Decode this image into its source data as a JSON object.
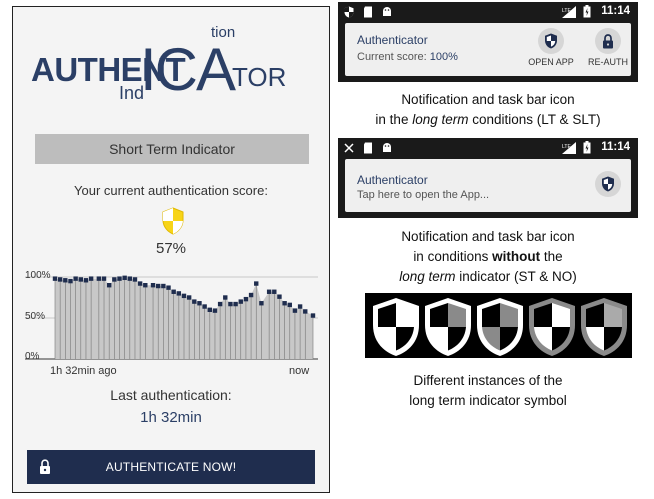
{
  "app": {
    "logo": {
      "part1": "AUTHENT",
      "part2": "ICA",
      "part3": "TOR",
      "superscript": "tion",
      "subscript": "Ind"
    },
    "short_term_indicator_label": "Short Term Indicator",
    "score_label": "Your current authentication score:",
    "score_value": "57%",
    "chart": {
      "y_labels": [
        "100%",
        "50%",
        "0%"
      ],
      "x_start_label": "1h 32min ago",
      "x_end_label": "now",
      "fill_color": "#c8c8c8",
      "point_color": "#1f2d4e"
    },
    "last_auth_label": "Last authentication:",
    "last_auth_value": "1h 32min",
    "authenticate_button": "AUTHENTICATE NOW!"
  },
  "chart_data": {
    "type": "area",
    "x": [
      0,
      2,
      4,
      6,
      8,
      10,
      12,
      14,
      17,
      19,
      21,
      23,
      25,
      27,
      29,
      31,
      33,
      35,
      38,
      40,
      42,
      44,
      46,
      48,
      50,
      52,
      54,
      56,
      58,
      60,
      62,
      64,
      66,
      68,
      70,
      72,
      74,
      76,
      78,
      80,
      83,
      85,
      87,
      89,
      91,
      93,
      95,
      97,
      100
    ],
    "values": [
      98,
      97,
      96,
      95,
      98,
      97,
      96,
      98,
      98,
      98,
      90,
      97,
      98,
      99,
      98,
      97,
      92,
      90,
      90,
      89,
      89,
      87,
      82,
      80,
      77,
      75,
      70,
      68,
      64,
      60,
      59,
      67,
      75,
      67,
      67,
      70,
      73,
      78,
      92,
      68,
      82,
      82,
      76,
      68,
      66,
      59,
      64,
      58,
      53
    ],
    "ylim": [
      0,
      100
    ],
    "ylabels": [
      "100%",
      "50%",
      "0%"
    ],
    "xlabels": [
      "1h 32min ago",
      "now"
    ]
  },
  "notifications": {
    "long_term": {
      "time": "11:14",
      "title": "Authenticator",
      "subtitle_prefix": "Current score:",
      "subtitle_value": "100%",
      "action1": "OPEN APP",
      "action2": "RE-AUTH"
    },
    "caption1_line1": "Notification and task bar icon",
    "caption1_line2_prefix": "in the",
    "caption1_line2_em": "long term",
    "caption1_line2_suffix": "conditions (LT & SLT)",
    "short_term": {
      "time": "11:14",
      "title": "Authenticator",
      "subtitle": "Tap here to open the App..."
    },
    "caption2_line1": "Notification and task bar icon",
    "caption2_line2_prefix": "in conditions",
    "caption2_line2_bold": "without",
    "caption2_line2_suffix": "the",
    "caption2_line3_em": "long term",
    "caption2_line3_suffix": "indicator (ST & NO)"
  },
  "symbols_caption_line1": "Different instances of the",
  "symbols_caption_line2": "long term indicator symbol"
}
